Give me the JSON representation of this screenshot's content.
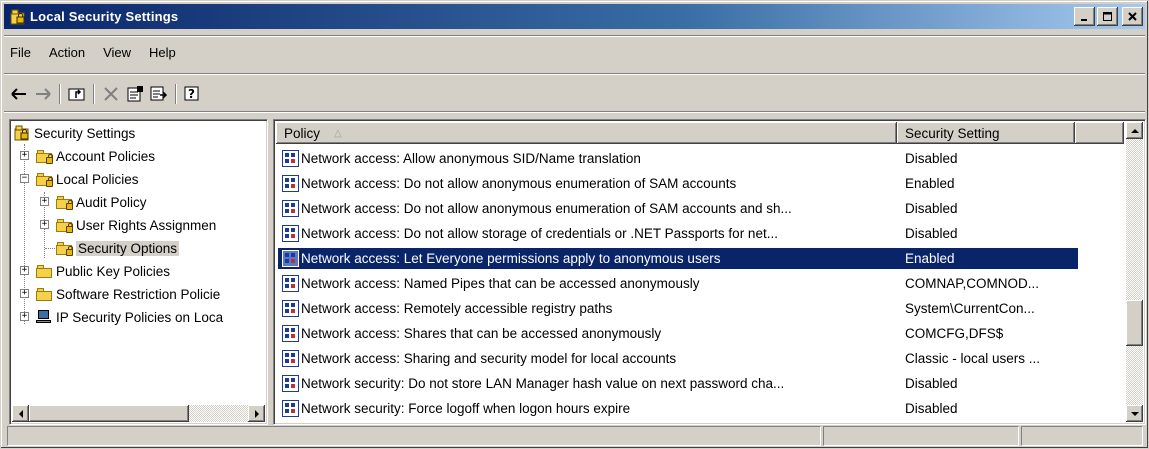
{
  "window": {
    "title": "Local Security Settings",
    "controls": {
      "minimize": "_",
      "maximize": "□",
      "close": "×"
    }
  },
  "menu": [
    "File",
    "Action",
    "View",
    "Help"
  ],
  "toolbar": [
    {
      "icon": "back-arrow-icon",
      "glyph": "⇦"
    },
    {
      "icon": "forward-arrow-icon",
      "glyph": "⇨"
    },
    {
      "icon": "up-folder-icon",
      "glyph": "🗀"
    },
    {
      "icon": "delete-icon",
      "glyph": "✕"
    },
    {
      "icon": "properties-icon",
      "glyph": "🗎"
    },
    {
      "icon": "export-list-icon",
      "glyph": "⎘"
    },
    {
      "icon": "help-icon",
      "glyph": "?"
    }
  ],
  "tree": [
    {
      "label": "Security Settings",
      "level": 0,
      "icon": "root-icon",
      "expander": ""
    },
    {
      "label": "Account Policies",
      "level": 1,
      "icon": "folder-lock-icon",
      "expander": "+"
    },
    {
      "label": "Local Policies",
      "level": 1,
      "icon": "folder-lock-icon",
      "expander": "−"
    },
    {
      "label": "Audit Policy",
      "level": 2,
      "icon": "folder-lock-icon",
      "expander": "+"
    },
    {
      "label": "User Rights Assignmen",
      "level": 2,
      "icon": "folder-lock-icon",
      "expander": "+"
    },
    {
      "label": "Security Options",
      "level": 2,
      "icon": "folder-lock-icon",
      "expander": "",
      "selected": true
    },
    {
      "label": "Public Key Policies",
      "level": 1,
      "icon": "folder-icon",
      "expander": "+"
    },
    {
      "label": "Software Restriction Policie",
      "level": 1,
      "icon": "folder-icon",
      "expander": "+"
    },
    {
      "label": "IP Security Policies on Loca",
      "level": 1,
      "icon": "computer-icon",
      "expander": "+"
    }
  ],
  "list": {
    "columns": {
      "policy": "Policy",
      "sort_indicator": "△",
      "setting": "Security Setting"
    },
    "rows": [
      {
        "policy": "Network access: Allow anonymous SID/Name translation",
        "setting": "Disabled"
      },
      {
        "policy": "Network access: Do not allow anonymous enumeration of SAM accounts",
        "setting": "Enabled"
      },
      {
        "policy": "Network access: Do not allow anonymous enumeration of SAM accounts and sh...",
        "setting": "Disabled"
      },
      {
        "policy": "Network access: Do not allow storage of credentials or .NET Passports for net...",
        "setting": "Disabled"
      },
      {
        "policy": "Network access: Let Everyone permissions apply to anonymous users",
        "setting": "Enabled",
        "selected": true
      },
      {
        "policy": "Network access: Named Pipes that can be accessed anonymously",
        "setting": "COMNAP,COMNOD..."
      },
      {
        "policy": "Network access: Remotely accessible registry paths",
        "setting": "System\\CurrentCon..."
      },
      {
        "policy": "Network access: Shares that can be accessed anonymously",
        "setting": "COMCFG,DFS$"
      },
      {
        "policy": "Network access: Sharing and security model for local accounts",
        "setting": "Classic - local users ..."
      },
      {
        "policy": "Network security: Do not store LAN Manager hash value on next password cha...",
        "setting": "Disabled"
      },
      {
        "policy": "Network security: Force logoff when logon hours expire",
        "setting": "Disabled"
      }
    ]
  },
  "status": [
    "",
    "",
    ""
  ],
  "colors": {
    "titlebar": "#0a246a",
    "selection": "#0a246a",
    "face": "#d4d0c8"
  }
}
